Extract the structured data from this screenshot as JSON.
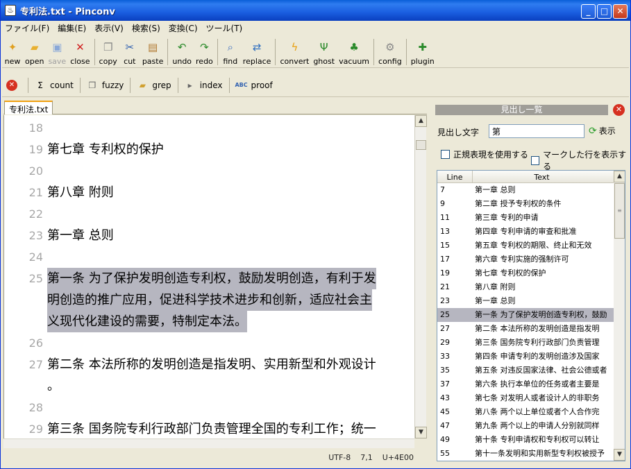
{
  "window": {
    "title": "专利法.txt - Pinconv",
    "app_icon": "flame-icon"
  },
  "menu": [
    "ファイル(F)",
    "編集(E)",
    "表示(V)",
    "検索(S)",
    "変換(C)",
    "ツール(T)"
  ],
  "toolbar": {
    "new": "new",
    "open": "open",
    "save": "save",
    "close": "close",
    "copy": "copy",
    "cut": "cut",
    "paste": "paste",
    "undo": "undo",
    "redo": "redo",
    "find": "find",
    "replace": "replace",
    "convert": "convert",
    "ghost": "ghost",
    "vacuum": "vacuum",
    "config": "config",
    "plugin": "plugin"
  },
  "toolbar2": {
    "count": "count",
    "fuzzy": "fuzzy",
    "grep": "grep",
    "index": "index",
    "proof": "proof"
  },
  "tab": {
    "label": "专利法.txt"
  },
  "editor": {
    "lines": [
      {
        "num": "18",
        "text": ""
      },
      {
        "num": "19",
        "text": "第七章 专利权的保护"
      },
      {
        "num": "20",
        "text": ""
      },
      {
        "num": "21",
        "text": "第八章 附则"
      },
      {
        "num": "22",
        "text": ""
      },
      {
        "num": "23",
        "text": "第一章 总则"
      },
      {
        "num": "24",
        "text": ""
      },
      {
        "num": "25",
        "text": "第一条 为了保护发明创造专利权，鼓励发明创造，有利于发"
      },
      {
        "num": "",
        "text": "明创造的推广应用，促进科学技术进步和创新，适应社会主"
      },
      {
        "num": "",
        "text": "义现代化建设的需要，特制定本法。"
      },
      {
        "num": "26",
        "text": ""
      },
      {
        "num": "27",
        "text": "第二条 本法所称的发明创造是指发明、实用新型和外观设计"
      },
      {
        "num": "",
        "text": "。"
      },
      {
        "num": "28",
        "text": ""
      },
      {
        "num": "29",
        "text": "第三条 国务院专利行政部门负责管理全国的专利工作；统一"
      }
    ]
  },
  "status": {
    "encoding": "UTF-8",
    "position": "7,1",
    "codepoint": "U+4E00"
  },
  "panel": {
    "title": "見出し一覧",
    "keyword_label": "見出し文字",
    "keyword_value": "第",
    "show_button": "表示",
    "regex_label": "正規表現を使用する",
    "marked_label": "マークした行を表示する",
    "col_line": "Line",
    "col_text": "Text",
    "rows": [
      {
        "line": "7",
        "text": "第一章 总则"
      },
      {
        "line": "9",
        "text": "第二章 授予专利权的条件"
      },
      {
        "line": "11",
        "text": "第三章 专利的申请"
      },
      {
        "line": "13",
        "text": "第四章 专利申请的审查和批准"
      },
      {
        "line": "15",
        "text": "第五章 专利权的期限、终止和无效"
      },
      {
        "line": "17",
        "text": "第六章 专利实施的强制许可"
      },
      {
        "line": "19",
        "text": "第七章 专利权的保护"
      },
      {
        "line": "21",
        "text": "第八章 附则"
      },
      {
        "line": "23",
        "text": "第一章 总则"
      },
      {
        "line": "25",
        "text": "第一条 为了保护发明创造专利权，鼓励"
      },
      {
        "line": "27",
        "text": "第二条 本法所称的发明创造是指发明"
      },
      {
        "line": "29",
        "text": "第三条 国务院专利行政部门负责管理"
      },
      {
        "line": "33",
        "text": "第四条 申请专利的发明创造涉及国家"
      },
      {
        "line": "35",
        "text": "第五条 对违反国家法律、社会公德或者"
      },
      {
        "line": "37",
        "text": "第六条 执行本单位的任务或者主要是"
      },
      {
        "line": "43",
        "text": "第七条 对发明人或者设计人的非职务"
      },
      {
        "line": "45",
        "text": "第八条 两个以上单位或者个人合作完"
      },
      {
        "line": "47",
        "text": "第九条 两个以上的申请人分别就同样"
      },
      {
        "line": "49",
        "text": "第十条 专利申请权和专利权可以转让"
      },
      {
        "line": "55",
        "text": "第十一条发明和实用新型专利权被授予"
      }
    ]
  }
}
